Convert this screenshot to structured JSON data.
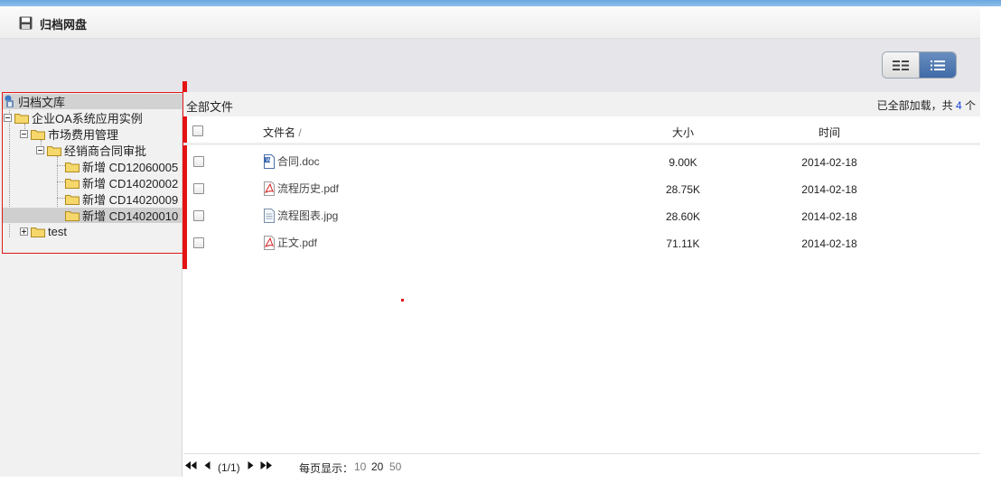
{
  "header": {
    "title": "归档网盘",
    "icon": "floppy-disk-icon"
  },
  "view_toggle": {
    "options": [
      "thumbnail-view",
      "list-view"
    ],
    "active": "list-view"
  },
  "tree": {
    "root": "归档文库",
    "nodes": [
      {
        "label": "企业OA系统应用实例"
      },
      {
        "label": "市场费用管理"
      },
      {
        "label": "经销商合同审批"
      },
      {
        "label": "新增 CD12060005"
      },
      {
        "label": "新增 CD14020002"
      },
      {
        "label": "新增 CD14020009"
      },
      {
        "label": "新增 CD14020010"
      },
      {
        "label": "test"
      }
    ]
  },
  "filebar": {
    "crumb": "全部文件",
    "status_prefix": "已全部加载，共 ",
    "count": "4",
    "status_suffix": " 个"
  },
  "table": {
    "headers": {
      "name": "文件名",
      "sort_mark": "/",
      "size": "大小",
      "time": "时间"
    },
    "rows": [
      {
        "name": "合同.doc",
        "size": "9.00K",
        "time": "2014-02-18",
        "icon": "word-file-icon"
      },
      {
        "name": "流程历史.pdf",
        "size": "28.75K",
        "time": "2014-02-18",
        "icon": "pdf-file-icon"
      },
      {
        "name": "流程图表.jpg",
        "size": "28.60K",
        "time": "2014-02-18",
        "icon": "generic-file-icon"
      },
      {
        "name": "正文.pdf",
        "size": "71.11K",
        "time": "2014-02-18",
        "icon": "pdf-file-icon"
      }
    ]
  },
  "pager": {
    "info": "(1/1)",
    "per_page_label": "每页显示：",
    "options": [
      "10",
      "20",
      "50"
    ],
    "active": "20"
  },
  "colors": {
    "accent": "#3f6aa6",
    "highlight": "#e01818",
    "count": "#1a3fd6"
  }
}
